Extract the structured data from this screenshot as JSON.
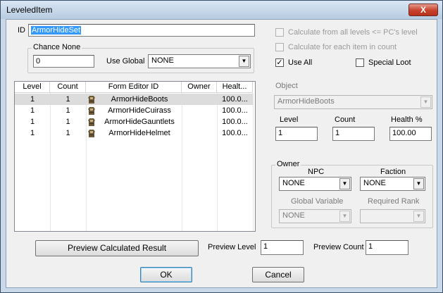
{
  "window": {
    "title": "LeveledItem",
    "close_symbol": "X"
  },
  "id_field": {
    "label": "ID",
    "value": "ArmorHideSet"
  },
  "chance_none": {
    "group_label": "Chance None",
    "value": "0",
    "use_global_label": "Use Global",
    "use_global_value": "NONE"
  },
  "options": {
    "calc_all_levels": "Calculate from all levels <= PC's level",
    "calc_each_item": "Calculate for each item in count",
    "use_all": "Use All",
    "use_all_checked": "✓",
    "special_loot": "Special Loot"
  },
  "table": {
    "headers": [
      "Level",
      "Count",
      "Form Editor ID",
      "Owner",
      "Healt..."
    ],
    "rows": [
      {
        "level": "1",
        "count": "1",
        "form_id": "ArmorHideBoots",
        "owner": "",
        "health": "100.0..."
      },
      {
        "level": "1",
        "count": "1",
        "form_id": "ArmorHideCuirass",
        "owner": "",
        "health": "100.0..."
      },
      {
        "level": "1",
        "count": "1",
        "form_id": "ArmorHideGauntlets",
        "owner": "",
        "health": "100.0..."
      },
      {
        "level": "1",
        "count": "1",
        "form_id": "ArmorHideHelmet",
        "owner": "",
        "health": "100.0..."
      }
    ]
  },
  "object": {
    "label": "Object",
    "value": "ArmorHideBoots",
    "level_label": "Level",
    "level_value": "1",
    "count_label": "Count",
    "count_value": "1",
    "health_label": "Health %",
    "health_value": "100.00"
  },
  "owner": {
    "group_label": "Owner",
    "npc_label": "NPC",
    "npc_value": "NONE",
    "faction_label": "Faction",
    "faction_value": "NONE",
    "global_var_label": "Global Variable",
    "global_var_value": "NONE",
    "required_rank_label": "Required Rank",
    "required_rank_value": ""
  },
  "preview": {
    "button_label": "Preview Calculated Result",
    "level_label": "Preview Level",
    "level_value": "1",
    "count_label": "Preview Count",
    "count_value": "1"
  },
  "buttons": {
    "ok": "OK",
    "cancel": "Cancel"
  },
  "icons": {
    "row_icon": "armor-icon",
    "dropdown": "chevron-down-icon"
  }
}
